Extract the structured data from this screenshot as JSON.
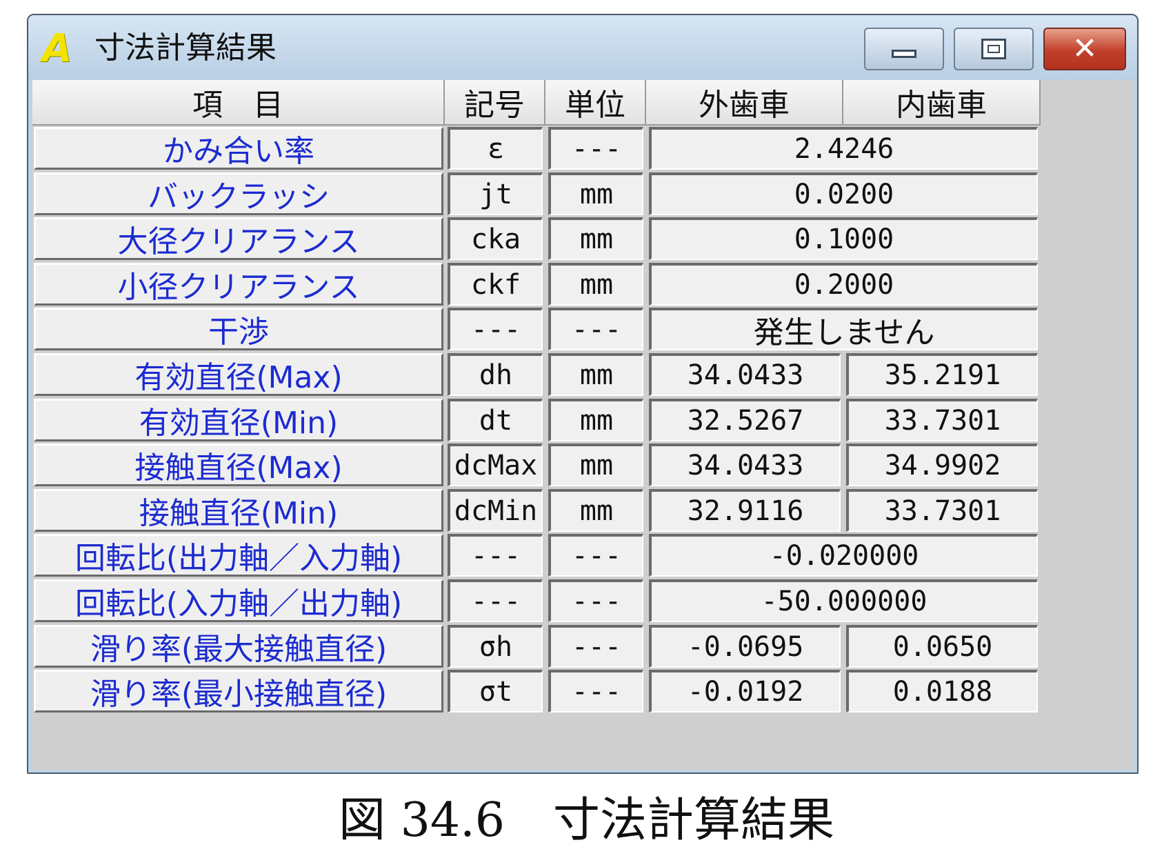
{
  "window": {
    "title": "寸法計算結果",
    "icon": "app-a-icon",
    "buttons": {
      "minimize": "minimize-icon",
      "maximize": "maximize-icon",
      "close": "close-icon"
    }
  },
  "table": {
    "headers": [
      "項　目",
      "記号",
      "単位",
      "外歯車",
      "内歯車"
    ],
    "rows": [
      {
        "label": "かみ合い率",
        "symbol": "ε",
        "unit": "---",
        "value": "2.4246"
      },
      {
        "label": "バックラッシ",
        "symbol": "jt",
        "unit": "mm",
        "value": "0.0200"
      },
      {
        "label": "大径クリアランス",
        "symbol": "cka",
        "unit": "mm",
        "value": "0.1000"
      },
      {
        "label": "小径クリアランス",
        "symbol": "ckf",
        "unit": "mm",
        "value": "0.2000"
      },
      {
        "label": "干渉",
        "symbol": "---",
        "unit": "---",
        "value": "発生しません"
      },
      {
        "label": "有効直径(Max)",
        "symbol": "dh",
        "unit": "mm",
        "ext": "34.0433",
        "int": "35.2191"
      },
      {
        "label": "有効直径(Min)",
        "symbol": "dt",
        "unit": "mm",
        "ext": "32.5267",
        "int": "33.7301"
      },
      {
        "label": "接触直径(Max)",
        "symbol": "dcMax",
        "unit": "mm",
        "ext": "34.0433",
        "int": "34.9902"
      },
      {
        "label": "接触直径(Min)",
        "symbol": "dcMin",
        "unit": "mm",
        "ext": "32.9116",
        "int": "33.7301"
      },
      {
        "label": "回転比(出力軸／入力軸)",
        "symbol": "---",
        "unit": "---",
        "value": "-0.020000"
      },
      {
        "label": "回転比(入力軸／出力軸)",
        "symbol": "---",
        "unit": "---",
        "value": "-50.000000"
      },
      {
        "label": "滑り率(最大接触直径)",
        "symbol": "σh",
        "unit": "---",
        "ext": "-0.0695",
        "int": "0.0650"
      },
      {
        "label": "滑り率(最小接触直径)",
        "symbol": "σt",
        "unit": "---",
        "ext": "-0.0192",
        "int": "0.0188"
      }
    ]
  },
  "caption": {
    "figure": "図 34.6",
    "title": "寸法計算結果"
  },
  "colors": {
    "label_text": "#1c2bd0",
    "title_bar": "#bfd3e6",
    "close_button": "#c2402a"
  }
}
